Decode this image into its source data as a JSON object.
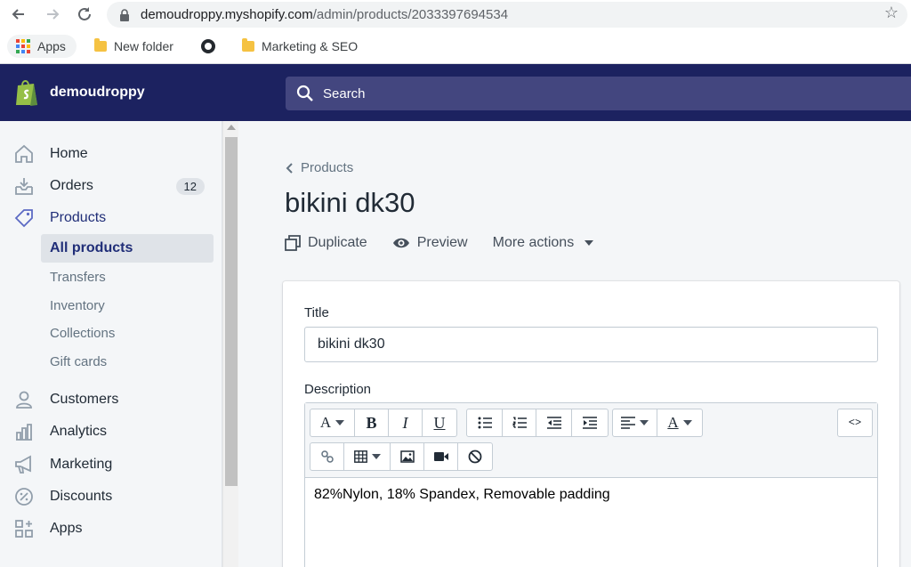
{
  "browser": {
    "url_host": "demoudroppy.myshopify.com",
    "url_path": "/admin/products/2033397694534",
    "bookmarks": [
      {
        "label": "Apps"
      },
      {
        "label": "New folder"
      },
      {
        "label": ""
      },
      {
        "label": "Marketing & SEO"
      }
    ]
  },
  "topbar": {
    "store_name": "demoudroppy",
    "search_placeholder": "Search"
  },
  "sidebar": {
    "items": [
      {
        "label": "Home"
      },
      {
        "label": "Orders",
        "badge": "12"
      },
      {
        "label": "Products"
      },
      {
        "label": "Customers"
      },
      {
        "label": "Analytics"
      },
      {
        "label": "Marketing"
      },
      {
        "label": "Discounts"
      },
      {
        "label": "Apps"
      }
    ],
    "product_subitems": [
      {
        "label": "All products"
      },
      {
        "label": "Transfers"
      },
      {
        "label": "Inventory"
      },
      {
        "label": "Collections"
      },
      {
        "label": "Gift cards"
      }
    ]
  },
  "page": {
    "breadcrumb": "Products",
    "title": "bikini dk30",
    "actions": {
      "duplicate": "Duplicate",
      "preview": "Preview",
      "more": "More actions"
    }
  },
  "form": {
    "title_label": "Title",
    "title_value": "bikini dk30",
    "description_label": "Description",
    "description_text": "82%Nylon, 18% Spandex, Removable padding",
    "toolbar": {
      "font": "A",
      "bold": "B",
      "italic": "I",
      "underline": "U",
      "color": "A",
      "code": "<>"
    }
  },
  "colors": {
    "topbar": "#1c2260",
    "search": "#43467f",
    "accent": "#202e78"
  }
}
